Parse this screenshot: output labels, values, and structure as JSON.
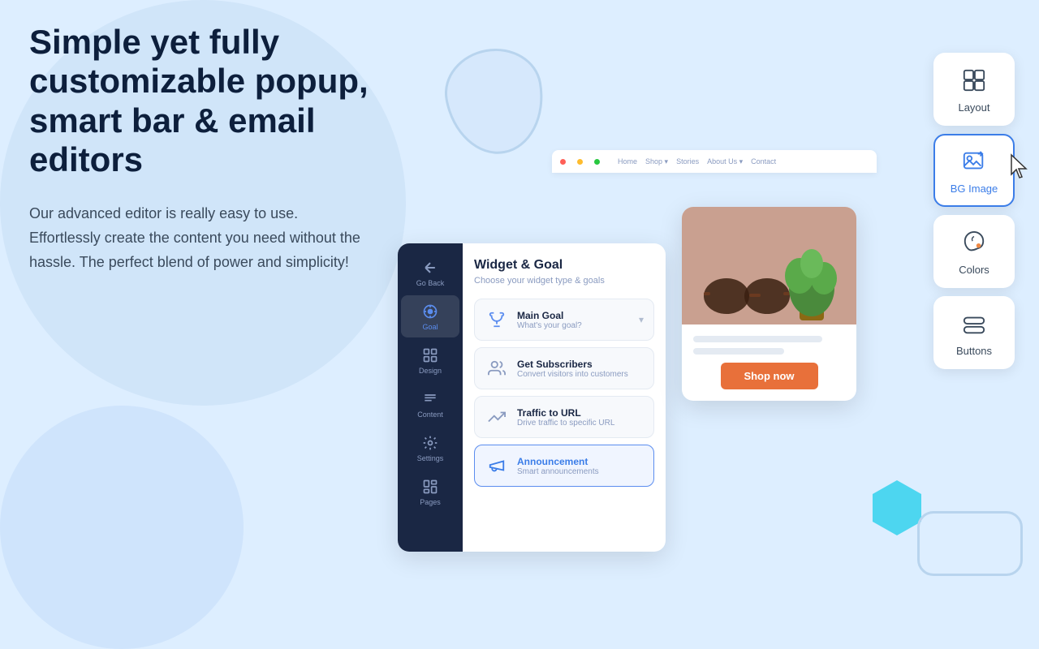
{
  "headline": "Simple yet fully customizable popup, smart bar & email editors",
  "subtext": "Our advanced editor is really easy to use. Effortlessly create the content you need without the hassle. The perfect blend of power and simplicity!",
  "widget": {
    "title": "Widget & Goal",
    "subtitle": "Choose your widget type & goals",
    "sidebar": [
      {
        "label": "Go Back",
        "icon": "back"
      },
      {
        "label": "Goal",
        "icon": "goal",
        "active": true
      },
      {
        "label": "Design",
        "icon": "design"
      },
      {
        "label": "Content",
        "icon": "content"
      },
      {
        "label": "Settings",
        "icon": "settings"
      },
      {
        "label": "Pages",
        "icon": "pages"
      }
    ],
    "goals": [
      {
        "name": "Main Goal",
        "desc": "What's your goal?",
        "icon": "trophy",
        "hasArrow": true
      },
      {
        "name": "Get Subscribers",
        "desc": "Convert visitors into customers",
        "icon": "subscribers"
      },
      {
        "name": "Traffic to URL",
        "desc": "Drive traffic to specific URL",
        "icon": "traffic"
      },
      {
        "name": "Announcement",
        "desc": "Smart announcements",
        "icon": "announcement",
        "selected": true
      }
    ]
  },
  "preview": {
    "shopButtonLabel": "Shop now"
  },
  "tools": [
    {
      "label": "Layout",
      "icon": "layout",
      "active": false
    },
    {
      "label": "BG Image",
      "icon": "bg-image",
      "active": true
    },
    {
      "label": "Colors",
      "icon": "colors",
      "active": false
    },
    {
      "label": "Buttons",
      "icon": "buttons",
      "active": false
    }
  ],
  "browser": {
    "navItems": [
      "Home",
      "Shop ▾",
      "Stories",
      "About Us ▾",
      "Contact"
    ]
  },
  "colors": {
    "accent": "#3b7de8",
    "dark": "#1a2744",
    "shopBtn": "#e8703a",
    "hex": "#4dd6f0"
  }
}
